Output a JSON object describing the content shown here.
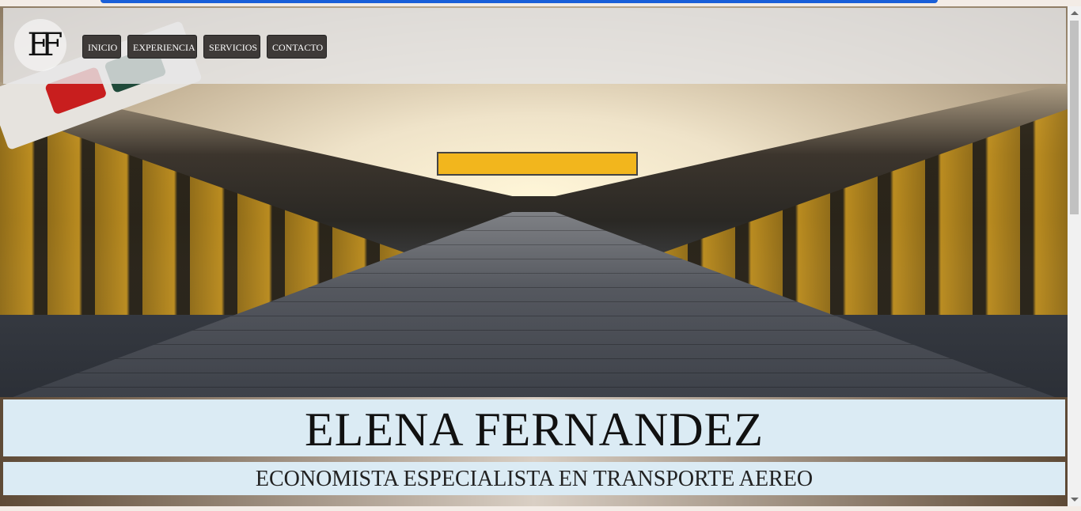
{
  "logo": {
    "text": "EF"
  },
  "nav": {
    "items": [
      {
        "label": "INICIO"
      },
      {
        "label": "EXPERIENCIA"
      },
      {
        "label": "SERVICIOS"
      },
      {
        "label": "CONTACTO"
      }
    ]
  },
  "hero": {
    "name": "ELENA FERNANDEZ",
    "subtitle": "ECONOMISTA ESPECIALISTA EN TRANSPORTE AEREO"
  },
  "colors": {
    "nav_button_bg": "#3e3a38",
    "title_band_bg": "#dbebf4",
    "top_accent": "#1a5fd8"
  },
  "icons": {
    "scroll_up": "chevron-up-icon",
    "scroll_down": "chevron-down-icon"
  }
}
